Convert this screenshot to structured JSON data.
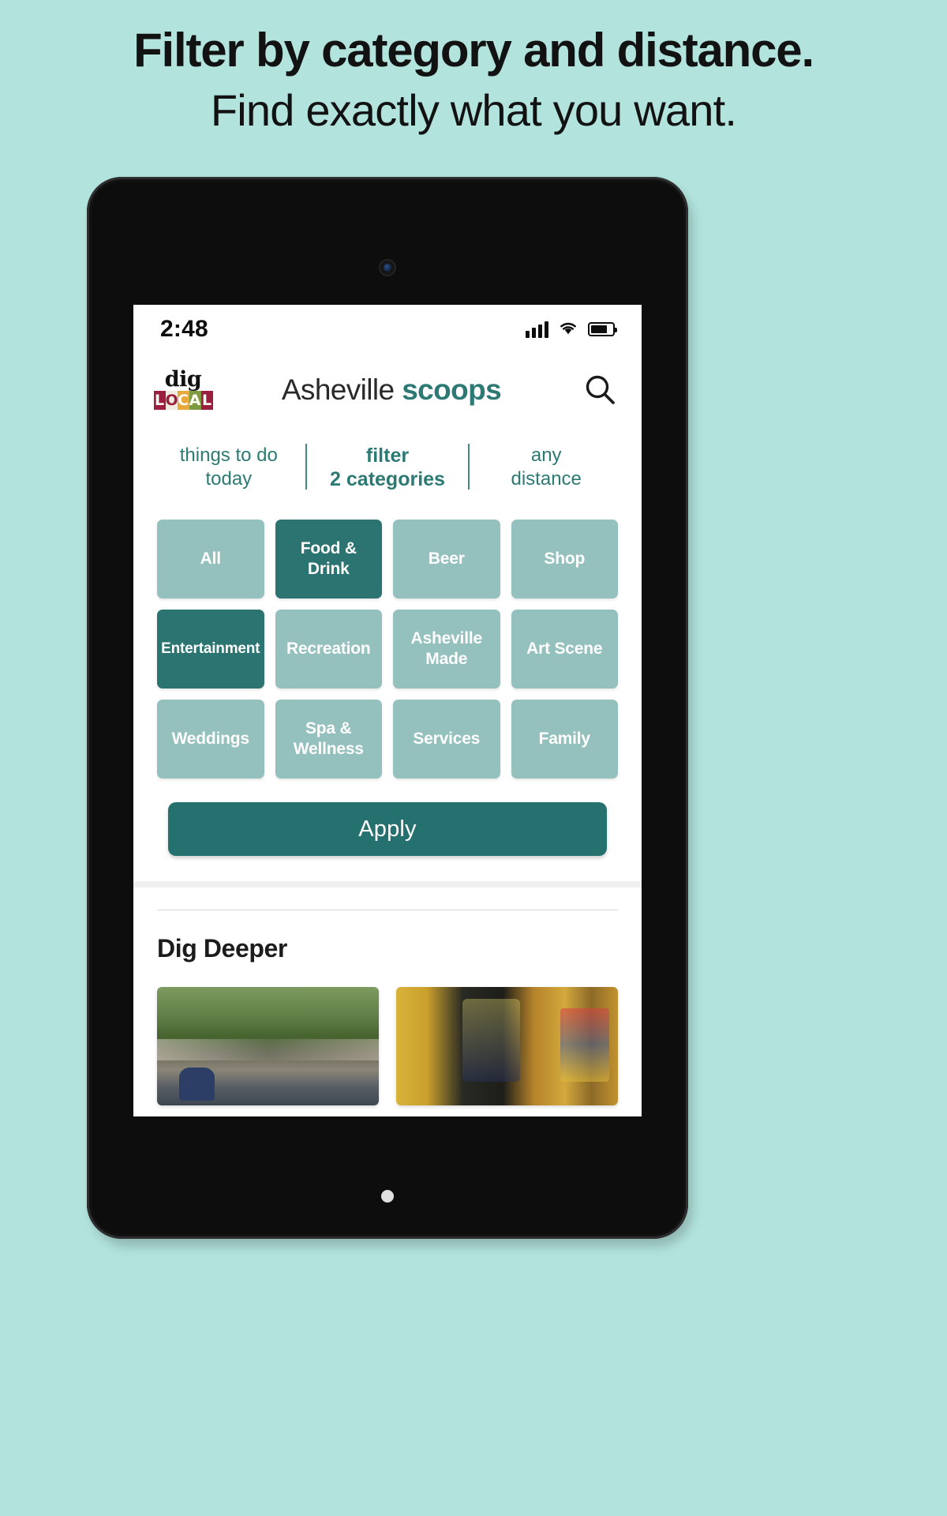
{
  "promo": {
    "headline_line1": "Filter by category and distance.",
    "headline_line2": "Find exactly what you want.",
    "background_color": "#b2e3dd"
  },
  "statusbar": {
    "time": "2:48",
    "signal_icon": "cellular-signal-icon",
    "wifi_icon": "wifi-icon",
    "battery_icon": "battery-icon"
  },
  "header": {
    "logo": {
      "name": "dig-local-logo",
      "word_top": "dig",
      "word_bottom_letters": [
        "L",
        "O",
        "C",
        "A",
        "L"
      ]
    },
    "title_regular": "Asheville ",
    "title_bold": "scoops",
    "search_icon": "search-icon",
    "brand_color": "#2d7a74"
  },
  "filter_tabs": [
    {
      "line1": "things to do",
      "line2": "today",
      "active": false
    },
    {
      "line1": "filter",
      "line2": "2 categories",
      "active": true
    },
    {
      "line1": "any",
      "line2": "distance",
      "active": false
    }
  ],
  "categories": {
    "tile_color": "#94c0bd",
    "tile_selected_color": "#2c7471",
    "items": [
      {
        "label": "All",
        "selected": false
      },
      {
        "label": "Food & Drink",
        "selected": true
      },
      {
        "label": "Beer",
        "selected": false
      },
      {
        "label": "Shop",
        "selected": false
      },
      {
        "label": "Entertainment",
        "selected": true
      },
      {
        "label": "Recreation",
        "selected": false
      },
      {
        "label": "Asheville Made",
        "selected": false
      },
      {
        "label": "Art Scene",
        "selected": false
      },
      {
        "label": "Weddings",
        "selected": false
      },
      {
        "label": "Spa & Wellness",
        "selected": false
      },
      {
        "label": "Services",
        "selected": false
      },
      {
        "label": "Family",
        "selected": false
      }
    ]
  },
  "apply": {
    "label": "Apply",
    "color": "#25716f"
  },
  "dig_deeper": {
    "title": "Dig Deeper",
    "cards": [
      {
        "name": "outdoor-festival-photo"
      },
      {
        "name": "colorful-market-shop-photo"
      }
    ]
  }
}
